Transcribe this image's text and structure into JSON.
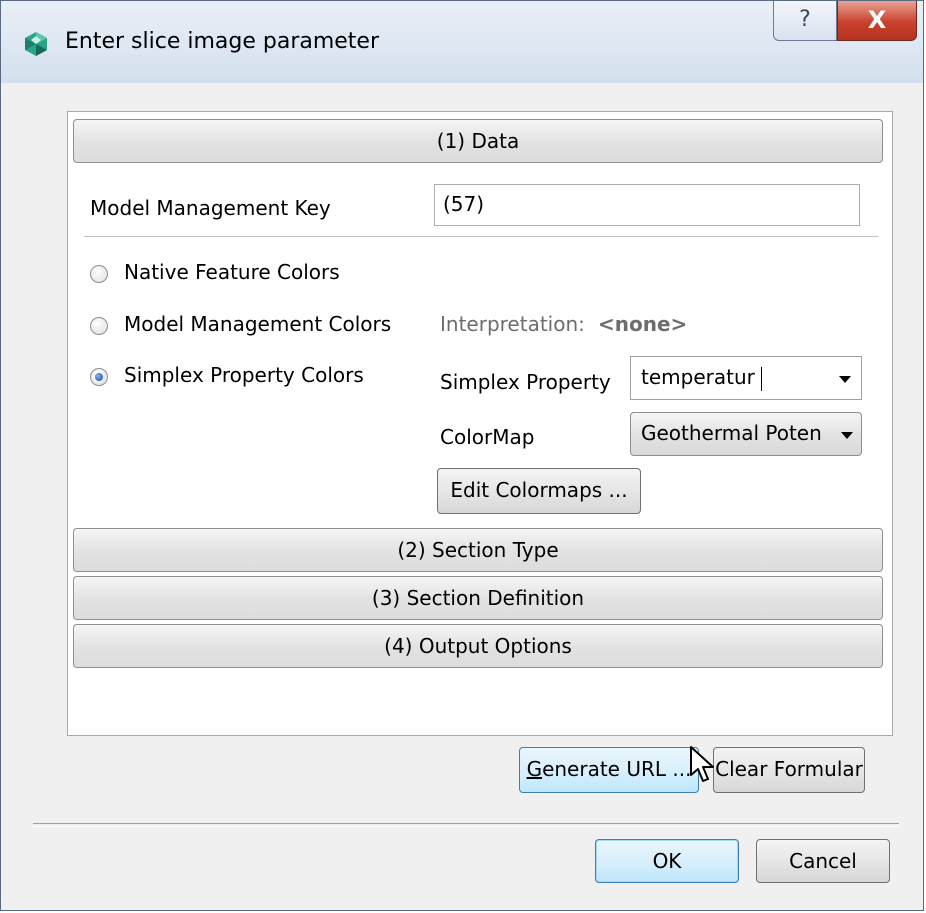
{
  "window": {
    "title": "Enter slice image parameter",
    "help_label": "?",
    "close_label": "X"
  },
  "sections": [
    {
      "label": "(1) Data"
    },
    {
      "label": "(2) Section Type"
    },
    {
      "label": "(3) Section Definition"
    },
    {
      "label": "(4) Output Options"
    }
  ],
  "data_section": {
    "model_key_label": "Model Management Key",
    "model_key_value": "(57)",
    "radios": [
      {
        "label": "Native Feature Colors",
        "checked": false
      },
      {
        "label": "Model Management Colors",
        "checked": false
      },
      {
        "label": "Simplex Property Colors",
        "checked": true
      }
    ],
    "interpretation_label": "Interpretation:",
    "interpretation_value": "<none>",
    "simplex_property_label": "Simplex Property",
    "simplex_property_value": "temperatur",
    "colormap_label": "ColorMap",
    "colormap_value": "Geothermal Poten",
    "edit_colormaps_label": "Edit Colormaps ..."
  },
  "actions": {
    "generate_url_mnemonic": "G",
    "generate_url_rest": "enerate URL ...",
    "clear_formular_label": "Clear Formular"
  },
  "dialog_buttons": {
    "ok_label": "OK",
    "cancel_label": "Cancel"
  },
  "colors": {
    "titlebar": "#d4e0ef",
    "close_button": "#c9402b",
    "radio_selected": "#1a4f9c",
    "hover_blue": "#bee6fd"
  }
}
